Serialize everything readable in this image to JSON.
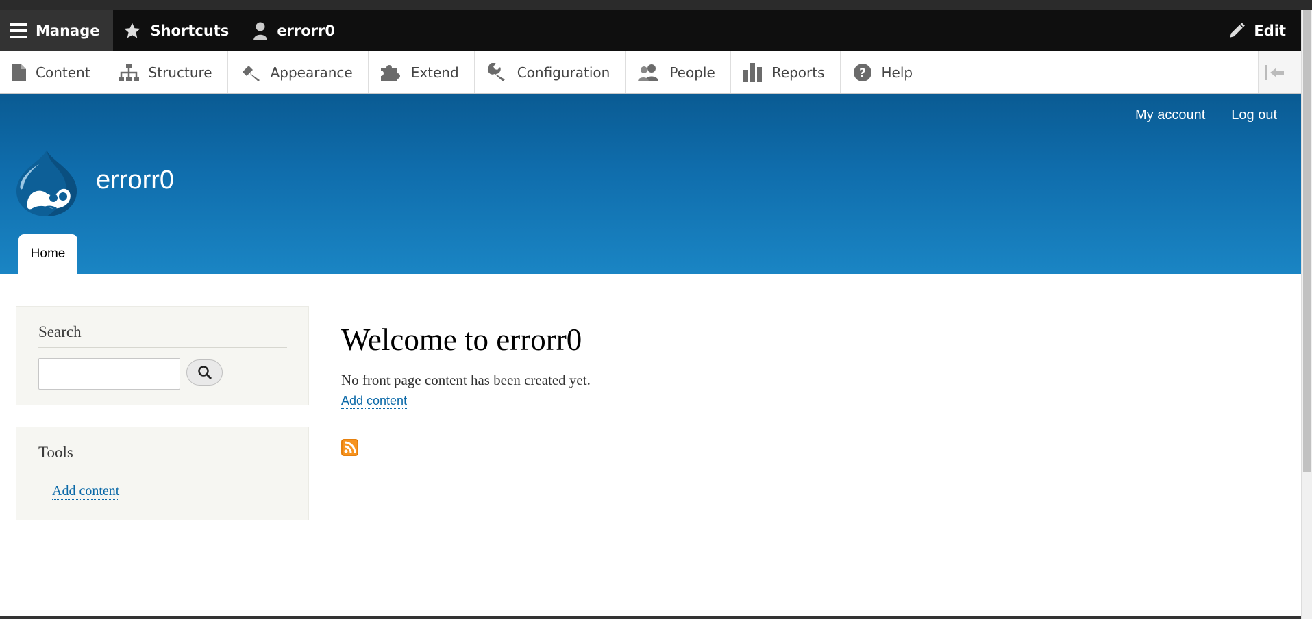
{
  "admin_toolbar": {
    "manage_label": "Manage",
    "shortcuts_label": "Shortcuts",
    "user_label": "errorr0",
    "edit_label": "Edit"
  },
  "admin_tray": {
    "items": [
      {
        "label": "Content",
        "icon": "file-icon"
      },
      {
        "label": "Structure",
        "icon": "sitemap-icon"
      },
      {
        "label": "Appearance",
        "icon": "paintbrush-icon"
      },
      {
        "label": "Extend",
        "icon": "puzzle-icon"
      },
      {
        "label": "Configuration",
        "icon": "wrench-icon"
      },
      {
        "label": "People",
        "icon": "people-icon"
      },
      {
        "label": "Reports",
        "icon": "bar-chart-icon"
      },
      {
        "label": "Help",
        "icon": "help-icon"
      }
    ]
  },
  "header": {
    "secondary_menu": [
      "My account",
      "Log out"
    ],
    "site_name": "errorr0",
    "primary_tab": "Home",
    "header_color": "#0f6cab"
  },
  "sidebar": {
    "search_block": {
      "title": "Search",
      "input_value": "",
      "button_icon": "search-icon"
    },
    "tools_block": {
      "title": "Tools",
      "link": "Add content"
    }
  },
  "main": {
    "title": "Welcome to errorr0",
    "message": "No front page content has been created yet.",
    "add_content_link": "Add content",
    "feed_icon": "rss-icon"
  }
}
